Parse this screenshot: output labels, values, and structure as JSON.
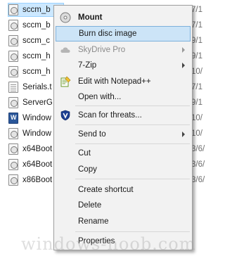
{
  "files": [
    {
      "name": "sccm_b",
      "icon": "disc-file-icon",
      "selected": true
    },
    {
      "name": "sccm_b",
      "icon": "disc-file-icon"
    },
    {
      "name": "sccm_c",
      "icon": "disc-file-icon"
    },
    {
      "name": "sccm_h",
      "icon": "disc-file-icon"
    },
    {
      "name": "sccm_h",
      "icon": "disc-file-icon"
    },
    {
      "name": "Serials.t",
      "icon": "text-file-icon"
    },
    {
      "name": "ServerG",
      "icon": "disc-file-icon"
    },
    {
      "name": "Window",
      "icon": "word-file-icon"
    },
    {
      "name": "Window",
      "icon": "disc-file-icon"
    },
    {
      "name": "x64Boot",
      "icon": "disc-file-icon"
    },
    {
      "name": "x64Boot",
      "icon": "disc-file-icon"
    },
    {
      "name": "x86Boot",
      "icon": "disc-file-icon"
    }
  ],
  "date_fragments": [
    "7/1",
    "7/1",
    "9/1",
    "9/1",
    "10/",
    "7/1",
    "9/1",
    "10/",
    "10/",
    "3/6/",
    "3/6/",
    "3/6/"
  ],
  "context_menu": {
    "mount": "Mount",
    "burn_disc_image": "Burn disc image",
    "skydrive_pro": "SkyDrive Pro",
    "seven_zip": "7-Zip",
    "edit_with_notepad": "Edit with Notepad++",
    "open_with": "Open with...",
    "scan_for_threats": "Scan for threats...",
    "send_to": "Send to",
    "cut": "Cut",
    "copy": "Copy",
    "create_shortcut": "Create shortcut",
    "delete": "Delete",
    "rename": "Rename",
    "properties": "Properties"
  },
  "watermark": "windows-noob.com",
  "colors": {
    "hover_bg": "#cce4f7",
    "hover_border": "#7db1dc",
    "menu_bg": "#f2f2f2",
    "selection_bg": "#cce8ff"
  }
}
